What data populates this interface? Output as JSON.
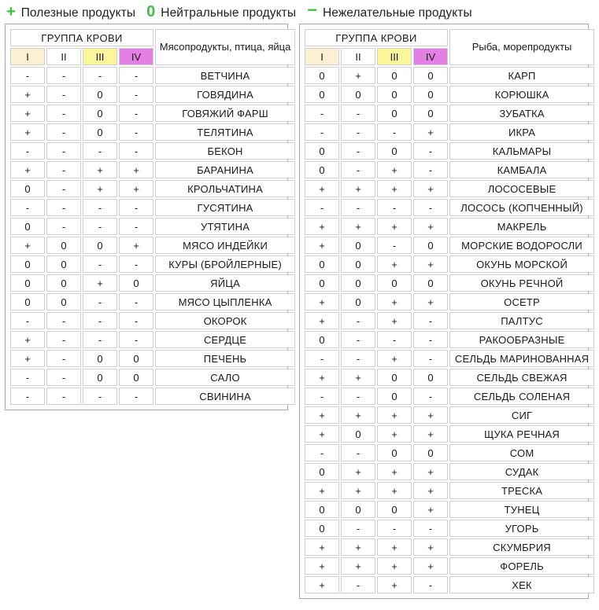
{
  "legend": {
    "items": [
      {
        "symbol": "+",
        "label": "Полезные продукты",
        "color": "#3cc23c"
      },
      {
        "symbol": "0",
        "label": "Нейтральные продукты",
        "color": "#3cc23c"
      },
      {
        "symbol": "−",
        "label": "Нежелательные продукты",
        "color": "#3cc23c"
      }
    ]
  },
  "blood_group_header": "ГРУППА КРОВИ",
  "blood_groups": [
    {
      "label": "I",
      "color": "#fbf0d2"
    },
    {
      "label": "II",
      "color": "#ffffff"
    },
    {
      "label": "III",
      "color": "#fbf59b"
    },
    {
      "label": "IV",
      "color": "#e47fe4"
    }
  ],
  "tables": [
    {
      "id": "meat",
      "name_header": "Мясопродукты, птица, яйца",
      "rows": [
        {
          "name": "ВЕТЧИНА",
          "marks": [
            "-",
            "-",
            "-",
            "-"
          ]
        },
        {
          "name": "ГОВЯДИНА",
          "marks": [
            "+",
            "-",
            "0",
            "-"
          ]
        },
        {
          "name": "ГОВЯЖИЙ ФАРШ",
          "marks": [
            "+",
            "-",
            "0",
            "-"
          ]
        },
        {
          "name": "ТЕЛЯТИНА",
          "marks": [
            "+",
            "-",
            "0",
            "-"
          ]
        },
        {
          "name": "БЕКОН",
          "marks": [
            "-",
            "-",
            "-",
            "-"
          ]
        },
        {
          "name": "БАРАНИНА",
          "marks": [
            "+",
            "-",
            "+",
            "+"
          ]
        },
        {
          "name": "КРОЛЬЧАТИНА",
          "marks": [
            "0",
            "-",
            "+",
            "+"
          ]
        },
        {
          "name": "ГУСЯТИНА",
          "marks": [
            "-",
            "-",
            "-",
            "-"
          ]
        },
        {
          "name": "УТЯТИНА",
          "marks": [
            "0",
            "-",
            "-",
            "-"
          ]
        },
        {
          "name": "МЯСО ИНДЕЙКИ",
          "marks": [
            "+",
            "0",
            "0",
            "+"
          ]
        },
        {
          "name": "КУРЫ (БРОЙЛЕРНЫЕ)",
          "marks": [
            "0",
            "0",
            "-",
            "-"
          ]
        },
        {
          "name": "ЯЙЦА",
          "marks": [
            "0",
            "0",
            "+",
            "0"
          ]
        },
        {
          "name": "МЯСО ЦЫПЛЕНКА",
          "marks": [
            "0",
            "0",
            "-",
            "-"
          ]
        },
        {
          "name": "ОКОРОК",
          "marks": [
            "-",
            "-",
            "-",
            "-"
          ]
        },
        {
          "name": "СЕРДЦЕ",
          "marks": [
            "+",
            "-",
            "-",
            "-"
          ]
        },
        {
          "name": "ПЕЧЕНЬ",
          "marks": [
            "+",
            "-",
            "0",
            "0"
          ]
        },
        {
          "name": "САЛО",
          "marks": [
            "-",
            "-",
            "0",
            "0"
          ]
        },
        {
          "name": "СВИНИНА",
          "marks": [
            "-",
            "-",
            "-",
            "-"
          ]
        }
      ]
    },
    {
      "id": "fish",
      "name_header": "Рыба, морепродукты",
      "rows": [
        {
          "name": "КАРП",
          "marks": [
            "0",
            "+",
            "0",
            "0"
          ]
        },
        {
          "name": "КОРЮШКА",
          "marks": [
            "0",
            "0",
            "0",
            "0"
          ]
        },
        {
          "name": "ЗУБАТКА",
          "marks": [
            "-",
            "-",
            "0",
            "0"
          ]
        },
        {
          "name": "ИКРА",
          "marks": [
            "-",
            "-",
            "-",
            "+"
          ]
        },
        {
          "name": "КАЛЬМАРЫ",
          "marks": [
            "0",
            "-",
            "0",
            "-"
          ]
        },
        {
          "name": "КАМБАЛА",
          "marks": [
            "0",
            "-",
            "+",
            "-"
          ]
        },
        {
          "name": "ЛОСОСЕВЫЕ",
          "marks": [
            "+",
            "+",
            "+",
            "+"
          ]
        },
        {
          "name": "ЛОСОСЬ (КОПЧЕННЫЙ)",
          "marks": [
            "-",
            "-",
            "-",
            "-"
          ]
        },
        {
          "name": "МАКРЕЛЬ",
          "marks": [
            "+",
            "+",
            "+",
            "+"
          ]
        },
        {
          "name": "МОРСКИЕ ВОДОРОСЛИ",
          "marks": [
            "+",
            "0",
            "-",
            "0"
          ]
        },
        {
          "name": "ОКУНЬ МОРСКОЙ",
          "marks": [
            "0",
            "0",
            "+",
            "+"
          ]
        },
        {
          "name": "ОКУНЬ РЕЧНОЙ",
          "marks": [
            "0",
            "0",
            "0",
            "0"
          ]
        },
        {
          "name": "ОСЕТР",
          "marks": [
            "+",
            "0",
            "+",
            "+"
          ]
        },
        {
          "name": "ПАЛТУС",
          "marks": [
            "+",
            "-",
            "+",
            "-"
          ]
        },
        {
          "name": "РАКООБРАЗНЫЕ",
          "marks": [
            "0",
            "-",
            "-",
            "-"
          ]
        },
        {
          "name": "СЕЛЬДЬ МАРИНОВАННАЯ",
          "marks": [
            "-",
            "-",
            "+",
            "-"
          ]
        },
        {
          "name": "СЕЛЬДЬ СВЕЖАЯ",
          "marks": [
            "+",
            "+",
            "0",
            "0"
          ]
        },
        {
          "name": "СЕЛЬДЬ СОЛЕНАЯ",
          "marks": [
            "-",
            "-",
            "0",
            "-"
          ]
        },
        {
          "name": "СИГ",
          "marks": [
            "+",
            "+",
            "+",
            "+"
          ]
        },
        {
          "name": "ЩУКА РЕЧНАЯ",
          "marks": [
            "+",
            "0",
            "+",
            "+"
          ]
        },
        {
          "name": "СОМ",
          "marks": [
            "-",
            "-",
            "0",
            "0"
          ]
        },
        {
          "name": "СУДАК",
          "marks": [
            "0",
            "+",
            "+",
            "+"
          ]
        },
        {
          "name": "ТРЕСКА",
          "marks": [
            "+",
            "+",
            "+",
            "+"
          ]
        },
        {
          "name": "ТУНЕЦ",
          "marks": [
            "0",
            "0",
            "0",
            "+"
          ]
        },
        {
          "name": "УГОРЬ",
          "marks": [
            "0",
            "-",
            "-",
            "-"
          ]
        },
        {
          "name": "СКУМБРИЯ",
          "marks": [
            "+",
            "+",
            "+",
            "+"
          ]
        },
        {
          "name": "ФОРЕЛЬ",
          "marks": [
            "+",
            "+",
            "+",
            "+"
          ]
        },
        {
          "name": "ХЕК",
          "marks": [
            "+",
            "-",
            "+",
            "-"
          ]
        }
      ]
    }
  ]
}
